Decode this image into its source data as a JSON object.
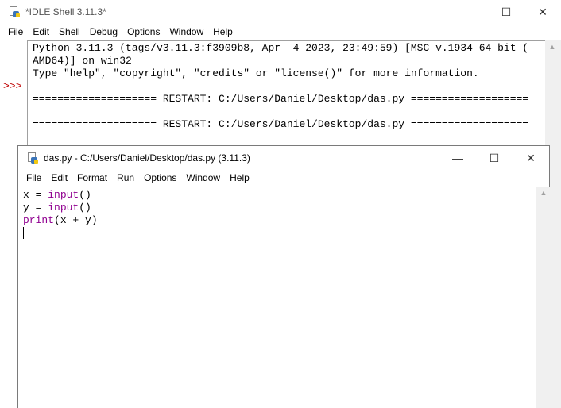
{
  "shell": {
    "title": "*IDLE Shell 3.11.3*",
    "controls": {
      "minimize": "—",
      "maximize": "☐",
      "close": "✕"
    },
    "menu": [
      "File",
      "Edit",
      "Shell",
      "Debug",
      "Options",
      "Window",
      "Help"
    ],
    "prompt": ">>>",
    "lines": [
      "Python 3.11.3 (tags/v3.11.3:f3909b8, Apr  4 2023, 23:49:59) [MSC v.1934 64 bit (",
      "AMD64)] on win32",
      "Type \"help\", \"copyright\", \"credits\" or \"license()\" for more information.",
      "",
      "==================== RESTART: C:/Users/Daniel/Desktop/das.py ===================",
      "",
      "==================== RESTART: C:/Users/Daniel/Desktop/das.py ==================="
    ]
  },
  "editor": {
    "title": "das.py - C:/Users/Daniel/Desktop/das.py (3.11.3)",
    "controls": {
      "minimize": "—",
      "maximize": "☐",
      "close": "✕"
    },
    "menu": [
      "File",
      "Edit",
      "Format",
      "Run",
      "Options",
      "Window",
      "Help"
    ],
    "code": [
      {
        "pre": "x = ",
        "kw": "input",
        "post": "()"
      },
      {
        "pre": "y = ",
        "kw": "input",
        "post": "()"
      },
      {
        "pre": "",
        "kw": "print",
        "post": "(x + y)"
      }
    ]
  },
  "colors": {
    "builtin": "#900090",
    "prompt": "#c00000"
  }
}
